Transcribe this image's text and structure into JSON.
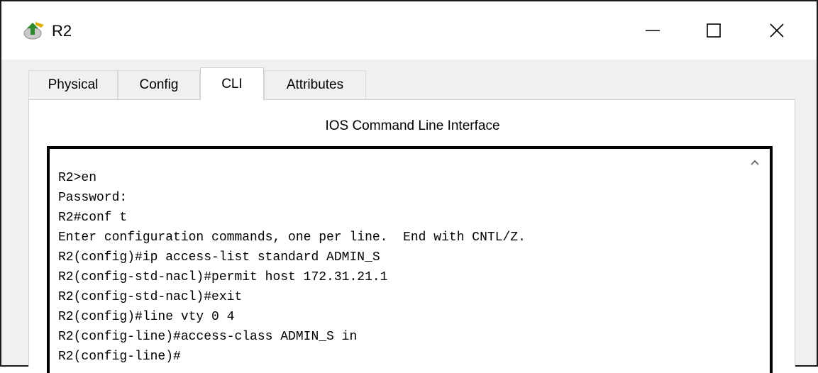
{
  "window": {
    "title": "R2",
    "app_icon": "packet-tracer-router-icon",
    "controls": [
      "minimize-icon",
      "maximize-icon",
      "close-icon"
    ]
  },
  "tabs": [
    {
      "label": "Physical",
      "active": false
    },
    {
      "label": "Config",
      "active": false
    },
    {
      "label": "CLI",
      "active": true
    },
    {
      "label": "Attributes",
      "active": false
    }
  ],
  "cli": {
    "heading": "IOS Command Line Interface",
    "lines": [
      "R2>en",
      "Password:",
      "R2#conf t",
      "Enter configuration commands, one per line.  End with CNTL/Z.",
      "R2(config)#ip access-list standard ADMIN_S",
      "R2(config-std-nacl)#permit host 172.31.21.1",
      "R2(config-std-nacl)#exit",
      "R2(config)#line vty 0 4",
      "R2(config-line)#access-class ADMIN_S in",
      "R2(config-line)#"
    ],
    "scroll_icon": "chevron-up-icon"
  }
}
